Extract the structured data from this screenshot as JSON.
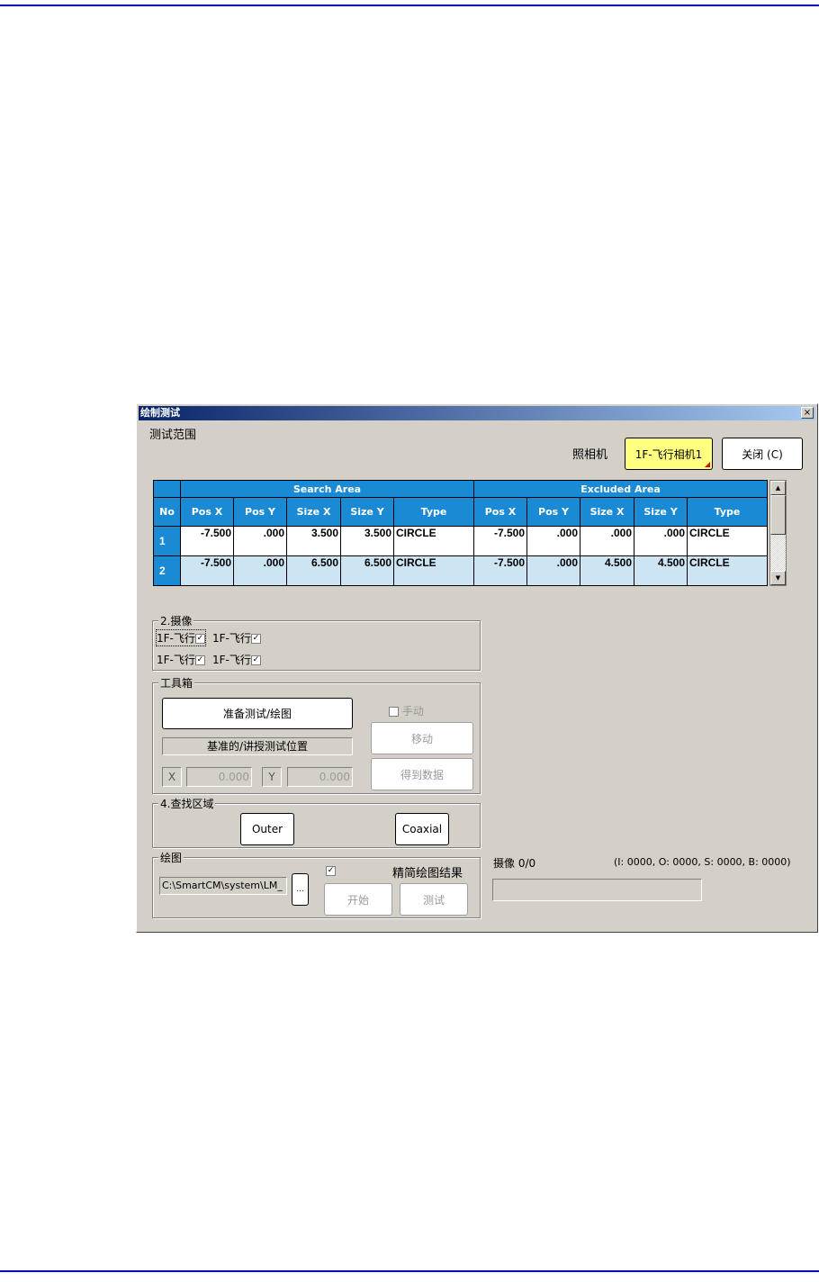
{
  "dialog": {
    "title": "绘制测试",
    "close_glyph": "×"
  },
  "range_label": "测试范围",
  "camera": {
    "label": "照相机",
    "value": "1F-飞行相机1",
    "accent": "#ffff80"
  },
  "close_button": "关闭 (C)",
  "table": {
    "group_headers": [
      "Search Area",
      "Excluded Area"
    ],
    "columns": [
      "No",
      "Pos X",
      "Pos Y",
      "Size X",
      "Size Y",
      "Type",
      "Pos X",
      "Pos Y",
      "Size X",
      "Size Y",
      "Type"
    ],
    "rows": [
      [
        "1",
        "-7.500",
        ".000",
        "3.500",
        "3.500",
        "CIRCLE",
        "-7.500",
        ".000",
        ".000",
        ".000",
        "CIRCLE"
      ],
      [
        "2",
        "-7.500",
        ".000",
        "6.500",
        "6.500",
        "CIRCLE",
        "-7.500",
        ".000",
        "4.500",
        "4.500",
        "CIRCLE"
      ]
    ],
    "header_color": "#1a8ad4",
    "alt_row_color": "#cde4f2"
  },
  "capture_group": {
    "label": "2.摄像",
    "items": [
      {
        "label": "1F-飞行",
        "checked": true
      },
      {
        "label": "1F-飞行",
        "checked": true
      },
      {
        "label": "1F-飞行",
        "checked": true
      },
      {
        "label": "1F-飞行",
        "checked": true
      }
    ],
    "check": "✓"
  },
  "toolbox": {
    "label": "工具箱",
    "prepare": "准备测试/绘图",
    "reference": "基准的/讲授测试位置",
    "manual": "手动",
    "move": "移动",
    "get_data": "得到数据",
    "x_label": "X",
    "x_value": "0.000",
    "y_label": "Y",
    "y_value": "0.000"
  },
  "search_region": {
    "label": "4.查找区域",
    "outer": "Outer",
    "coaxial": "Coaxial"
  },
  "drawing": {
    "label": "绘图",
    "path": "C:\\SmartCM\\system\\LM_",
    "browse": "...",
    "simplify_checked": true,
    "simplify_label": "精简绘图结果",
    "start": "开始",
    "test": "测试",
    "check": "✓"
  },
  "status": {
    "capture": "摄像 0/0",
    "counts": "(I: 0000, O: 0000, S: 0000, B: 0000)",
    "progress": 0
  }
}
